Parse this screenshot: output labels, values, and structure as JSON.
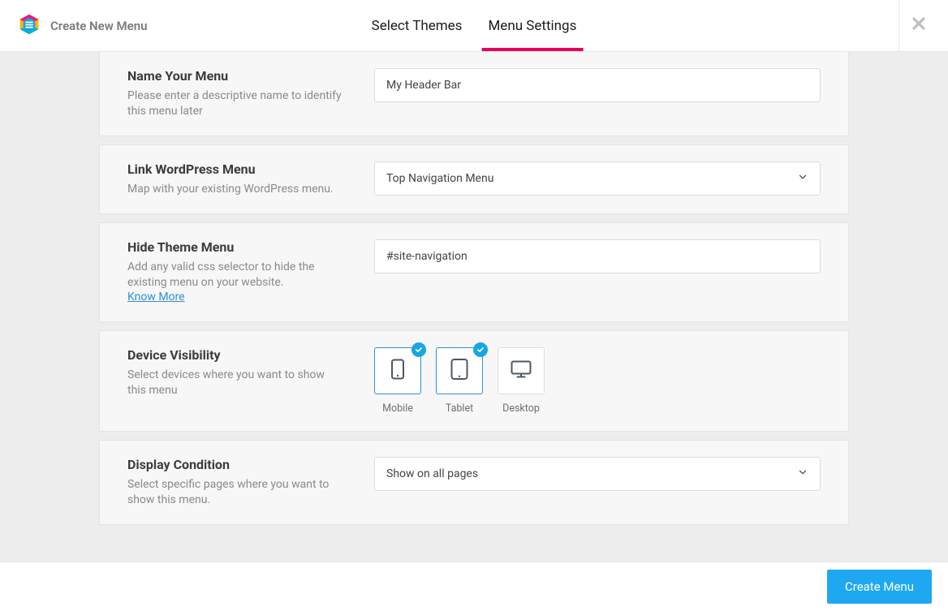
{
  "header": {
    "title": "Create New Menu",
    "tabs": [
      "Select Themes",
      "Menu Settings"
    ],
    "activeTab": 1
  },
  "sections": {
    "nameMenu": {
      "title": "Name Your Menu",
      "desc": "Please enter a descriptive name to identify this menu later",
      "value": "My Header Bar"
    },
    "linkMenu": {
      "title": "Link WordPress Menu",
      "desc": "Map with your existing WordPress menu.",
      "value": "Top Navigation Menu"
    },
    "hideTheme": {
      "title": "Hide Theme Menu",
      "desc": "Add any valid css selector to hide the existing menu on your website.",
      "link": "Know More",
      "value": "#site-navigation"
    },
    "deviceVis": {
      "title": "Device Visibility",
      "desc": "Select devices where you want to show this menu",
      "devices": [
        {
          "key": "mobile",
          "label": "Mobile",
          "selected": true
        },
        {
          "key": "tablet",
          "label": "Tablet",
          "selected": true
        },
        {
          "key": "desktop",
          "label": "Desktop",
          "selected": false
        }
      ]
    },
    "displayCond": {
      "title": "Display Condition",
      "desc": "Select specific pages where you want to show this menu.",
      "value": "Show on all pages"
    }
  },
  "footer": {
    "primaryButton": "Create Menu"
  }
}
